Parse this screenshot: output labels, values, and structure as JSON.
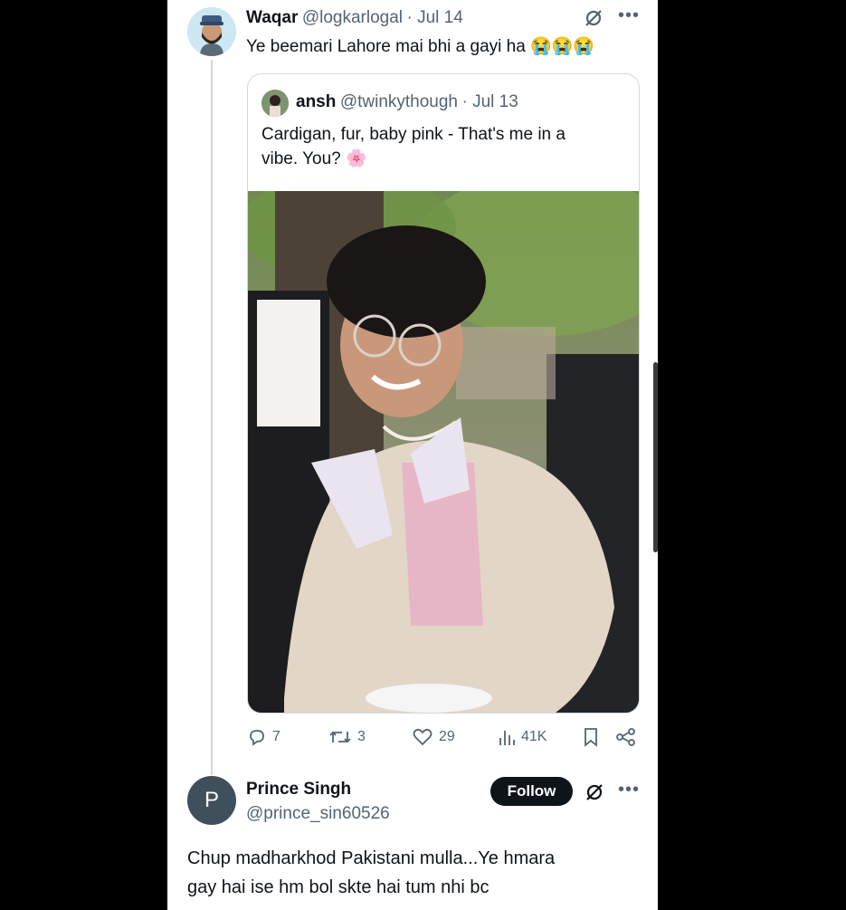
{
  "main_tweet": {
    "name": "Waqar",
    "handle": "@logkarlogal",
    "date": "· Jul 14",
    "text": "Ye beemari Lahore mai bhi a gayi ha",
    "emoji": "😭😭😭"
  },
  "quoted_tweet": {
    "name": "ansh",
    "handle": "@twinkythough",
    "date": "· Jul 13",
    "text_line1": "Cardigan, fur, baby pink - That's me in a",
    "text_line2": "vibe. You?",
    "emoji": "🌸"
  },
  "actions": {
    "replies": "7",
    "retweets": "3",
    "likes": "29",
    "views": "41K"
  },
  "reply": {
    "name": "Prince Singh",
    "handle": "@prince_sin60526",
    "avatar_letter": "P",
    "follow_label": "Follow",
    "text_line1": "Chup madharkhod Pakistani mulla...Ye hmara",
    "text_line2": "gay hai ise hm bol skte hai tum nhi bc"
  },
  "colors": {
    "text": "#0f1419",
    "secondary": "#536471",
    "border": "#cfd9de",
    "follow_bg": "#0f1419",
    "reply_avatar_bg": "#3f4f5c"
  },
  "icons": [
    "grok-icon",
    "more-icon",
    "reply-icon",
    "retweet-icon",
    "like-icon",
    "views-icon",
    "bookmark-icon",
    "share-icon"
  ]
}
